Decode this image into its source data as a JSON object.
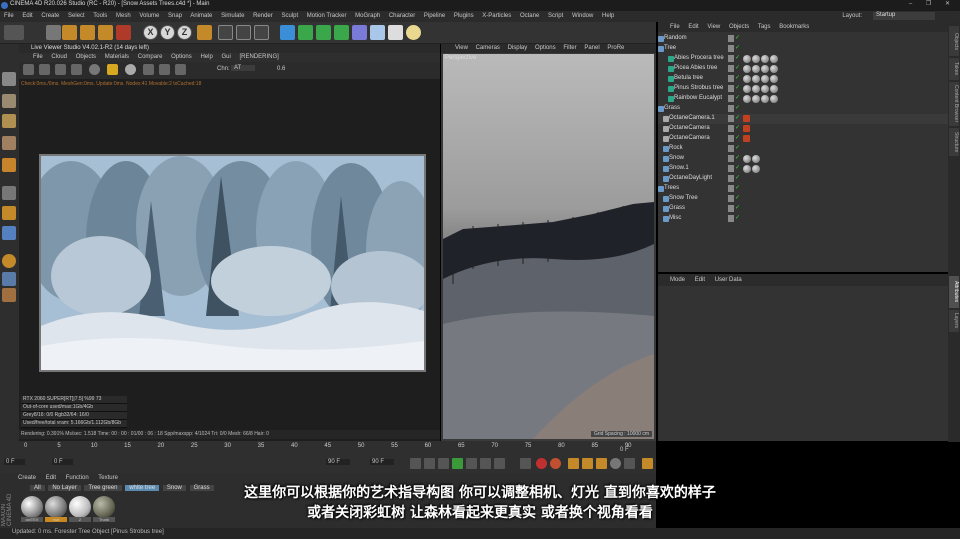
{
  "window": {
    "title": "CINEMA 4D R20.026 Studio (RC - R20) - [Snow Assets Trees.c4d *] - Main",
    "controls": "– ❐ ✕"
  },
  "menubar": {
    "items": [
      "File",
      "Edit",
      "Create",
      "Select",
      "Tools",
      "Mesh",
      "Volume",
      "Snap",
      "Animate",
      "Simulate",
      "Render",
      "Sculpt",
      "Motion Tracker",
      "MoGraph",
      "Character",
      "Pipeline",
      "Plugins",
      "X-Particles",
      "Octane",
      "Script",
      "Window",
      "Help"
    ],
    "layout_label": "Layout:",
    "layout_value": "Startup"
  },
  "toolbar": {
    "axis_x": "X",
    "axis_y": "Y",
    "axis_z": "Z"
  },
  "live_viewer": {
    "title": "Live Viewer Studio V4.02.1-R2 (14 days left)",
    "menu": [
      "File",
      "Cloud",
      "Objects",
      "Materials",
      "Compare",
      "Options",
      "Help",
      "Gui"
    ],
    "mode_badge": "[RENDERING]",
    "chn_label": "Chn:",
    "chn_value": "AT",
    "zoom_value": "0.6",
    "status_line": "Check:0ms./0ms. MeshGen:0ms. Update:0ms. Nodes:41 Movable:2 txCached:18",
    "gpu_rows": [
      "RTX 2060 SUPER[RT]|7.5]      %99     73",
      "Out-of-core used/max:1Gb/4Gb",
      "Grey8/16: 0/0        Rgb32/64: 16/0",
      "Used/free/total vram: 5.166Gb/1.112Gb/8Gb"
    ],
    "render_stats": "Rendering: 0.391%   Ms/sec: 1.518   Time: 00 : 00 : 01/00 : 06 : 18   Spp/maxspp: 4/1024   Tri: 0/0   Mesh: 66/8   Hair: 0"
  },
  "viewport": {
    "menu": [
      "View",
      "Cameras",
      "Display",
      "Options",
      "Filter",
      "Panel",
      "ProRe"
    ],
    "label": "Perspective",
    "grid_spacing": "Grid Spacing : 10000 cm"
  },
  "object_manager": {
    "menu": [
      "File",
      "Edit",
      "View",
      "Objects",
      "Tags",
      "Bookmarks"
    ],
    "rows": [
      {
        "name": "Random",
        "indent": 0,
        "color": "#ddd"
      },
      {
        "name": "Tree",
        "indent": 0,
        "color": "#ddd"
      },
      {
        "name": "Abies Procera tree",
        "indent": 2,
        "color": "#ddd"
      },
      {
        "name": "Picea Abies tree",
        "indent": 2,
        "color": "#ddd"
      },
      {
        "name": "Betula tree",
        "indent": 2,
        "color": "#ddd"
      },
      {
        "name": "Pinus Strobus tree",
        "indent": 2,
        "color": "#ddd"
      },
      {
        "name": "Rainbow Eucalypt",
        "indent": 2,
        "color": "#ddd"
      },
      {
        "name": "Grass",
        "indent": 0,
        "color": "#ddd"
      },
      {
        "name": "OctaneCamera.1",
        "indent": 1,
        "color": "#ddd"
      },
      {
        "name": "OctaneCamera",
        "indent": 1,
        "color": "#ddd"
      },
      {
        "name": "OctaneCamera",
        "indent": 1,
        "color": "#ddd"
      },
      {
        "name": "Rock",
        "indent": 1,
        "color": "#ddd"
      },
      {
        "name": "Snow",
        "indent": 1,
        "color": "#ddd"
      },
      {
        "name": "Snow.1",
        "indent": 1,
        "color": "#ddd"
      },
      {
        "name": "OctaneDayLight",
        "indent": 1,
        "color": "#ddd"
      },
      {
        "name": "Trees",
        "indent": 0,
        "color": "#ddd"
      },
      {
        "name": "Snow Tree",
        "indent": 1,
        "color": "#ddd"
      },
      {
        "name": "Grass",
        "indent": 1,
        "color": "#ddd"
      },
      {
        "name": "Misc",
        "indent": 1,
        "color": "#ddd"
      }
    ]
  },
  "attribute_manager": {
    "menu": [
      "Mode",
      "Edit",
      "User Data"
    ]
  },
  "right_tabs": [
    "Objects",
    "Takes",
    "Content Browser",
    "Structure",
    "Attributes",
    "Layers"
  ],
  "timeline": {
    "ticks": [
      "0",
      "5",
      "10",
      "15",
      "20",
      "25",
      "30",
      "35",
      "40",
      "45",
      "50",
      "55",
      "60",
      "65",
      "70",
      "75",
      "80",
      "85",
      "90"
    ],
    "start_field": "0 F",
    "current_field": "0 F",
    "end_field": "90 F",
    "end_field2": "90 F",
    "frame_readout": "0 F"
  },
  "material_manager": {
    "menu": [
      "Create",
      "Edit",
      "Function",
      "Texture"
    ],
    "tabs": [
      "All",
      "No Layer",
      "Tree green",
      "white tree",
      "Snow",
      "Grass"
    ],
    "materials": [
      "octTEX",
      "mat",
      "2",
      "Trunk"
    ]
  },
  "status_bar": {
    "text": "Updated: 0 ms.      Forester Tree Object [Pinus Strobus tree]"
  },
  "subtitles": {
    "line1": "这里你可以根据你的艺术指导构图 你可以调整相机、灯光 直到你喜欢的样子",
    "line2": "或者关闭彩虹树 让森林看起来更真实 或者换个视角看看"
  },
  "logo_text": "MAXON CINEMA 4D"
}
